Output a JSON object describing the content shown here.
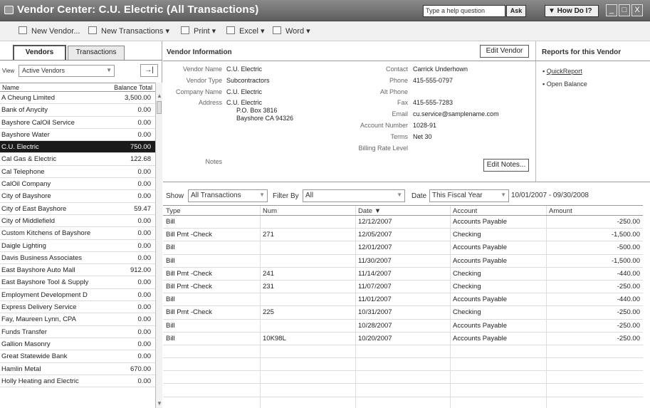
{
  "window": {
    "title": "Vendor Center: C.U. Electric (All Transactions)",
    "help_placeholder": "Type a help question",
    "ask_label": "Ask",
    "howdo_label": "▼ How Do I?",
    "min": "_",
    "max": "□",
    "close": "X"
  },
  "toolbar": {
    "new_vendor": "New Vendor...",
    "new_transactions": "New Transactions ▾",
    "print": "Print ▾",
    "excel": "Excel ▾",
    "word": "Word ▾"
  },
  "left": {
    "tabs": [
      "Vendors",
      "Transactions"
    ],
    "view_label": "View",
    "view_value": "Active Vendors",
    "col_name": "Name",
    "col_balance": "Balance Total",
    "rows": [
      {
        "name": "A Cheung Limited",
        "balance": "3,500.00"
      },
      {
        "name": "Bank of Anycity",
        "balance": "0.00"
      },
      {
        "name": "Bayshore CalOil Service",
        "balance": "0.00"
      },
      {
        "name": "Bayshore Water",
        "balance": "0.00"
      },
      {
        "name": "C.U. Electric",
        "balance": "750.00"
      },
      {
        "name": "Cal Gas & Electric",
        "balance": "122.68"
      },
      {
        "name": "Cal Telephone",
        "balance": "0.00"
      },
      {
        "name": "CalOil Company",
        "balance": "0.00"
      },
      {
        "name": "City of Bayshore",
        "balance": "0.00"
      },
      {
        "name": "City of East Bayshore",
        "balance": "59.47"
      },
      {
        "name": "City of Middlefield",
        "balance": "0.00"
      },
      {
        "name": "Custom Kitchens of Bayshore",
        "balance": "0.00"
      },
      {
        "name": "Daigle Lighting",
        "balance": "0.00"
      },
      {
        "name": "Davis Business Associates",
        "balance": "0.00"
      },
      {
        "name": "East Bayshore Auto Mall",
        "balance": "912.00"
      },
      {
        "name": "East Bayshore Tool & Supply",
        "balance": "0.00"
      },
      {
        "name": "Employment Development D",
        "balance": "0.00"
      },
      {
        "name": "Express Delivery Service",
        "balance": "0.00"
      },
      {
        "name": "Fay, Maureen Lynn, CPA",
        "balance": "0.00"
      },
      {
        "name": "Funds Transfer",
        "balance": "0.00"
      },
      {
        "name": "Gallion Masonry",
        "balance": "0.00"
      },
      {
        "name": "Great Statewide Bank",
        "balance": "0.00"
      },
      {
        "name": "Hamlin Metal",
        "balance": "670.00"
      },
      {
        "name": "Holly Heating and Electric",
        "balance": "0.00"
      }
    ]
  },
  "vendor_info": {
    "title": "Vendor Information",
    "edit_vendor": "Edit Vendor",
    "labels": {
      "vendor_name": "Vendor Name",
      "vendor_type": "Vendor Type",
      "company_name": "Company Name",
      "address": "Address",
      "contact": "Contact",
      "phone": "Phone",
      "alt_phone": "Alt Phone",
      "fax": "Fax",
      "email": "Email",
      "account_number": "Account Number",
      "terms": "Terms",
      "billing_rate": "Billing Rate Level",
      "notes": "Notes"
    },
    "vendor_name": "C.U. Electric",
    "vendor_type": "Subcontractors",
    "company_name": "C.U. Electric",
    "address_1": "C.U. Electric",
    "address_2": "P.O. Box 3816",
    "address_3": "Bayshore CA 94326",
    "contact": "Carrick Underhown",
    "phone": "415-555-0797",
    "fax": "415-555-7283",
    "email": "cu.service@samplename.com",
    "account_number": "1028-91",
    "terms": "Net 30",
    "edit_notes": "Edit Notes..."
  },
  "reports": {
    "title": "Reports for this Vendor",
    "quickreport": "QuickReport",
    "open_balance": "Open Balance"
  },
  "filters": {
    "show_label": "Show",
    "show_value": "All Transactions",
    "filter_label": "Filter By",
    "filter_value": "All",
    "date_label": "Date",
    "date_value": "This Fiscal Year",
    "date_range": "10/01/2007 - 09/30/2008"
  },
  "grid": {
    "headers": {
      "type": "Type",
      "num": "Num",
      "date": "Date ▼",
      "account": "Account",
      "amount": "Amount"
    },
    "rows": [
      {
        "type": "Bill",
        "num": "",
        "date": "12/12/2007",
        "account": "Accounts Payable",
        "amount": "-250.00"
      },
      {
        "type": "Bill Pmt -Check",
        "num": "271",
        "date": "12/05/2007",
        "account": "Checking",
        "amount": "-1,500.00"
      },
      {
        "type": "Bill",
        "num": "",
        "date": "12/01/2007",
        "account": "Accounts Payable",
        "amount": "-500.00"
      },
      {
        "type": "Bill",
        "num": "",
        "date": "11/30/2007",
        "account": "Accounts Payable",
        "amount": "-1,500.00"
      },
      {
        "type": "Bill Pmt -Check",
        "num": "241",
        "date": "11/14/2007",
        "account": "Checking",
        "amount": "-440.00"
      },
      {
        "type": "Bill Pmt -Check",
        "num": "231",
        "date": "11/07/2007",
        "account": "Checking",
        "amount": "-250.00"
      },
      {
        "type": "Bill",
        "num": "",
        "date": "11/01/2007",
        "account": "Accounts Payable",
        "amount": "-440.00"
      },
      {
        "type": "Bill Pmt -Check",
        "num": "225",
        "date": "10/31/2007",
        "account": "Checking",
        "amount": "-250.00"
      },
      {
        "type": "Bill",
        "num": "",
        "date": "10/28/2007",
        "account": "Accounts Payable",
        "amount": "-250.00"
      },
      {
        "type": "Bill",
        "num": "10K98L",
        "date": "10/20/2007",
        "account": "Accounts Payable",
        "amount": "-250.00"
      }
    ]
  }
}
